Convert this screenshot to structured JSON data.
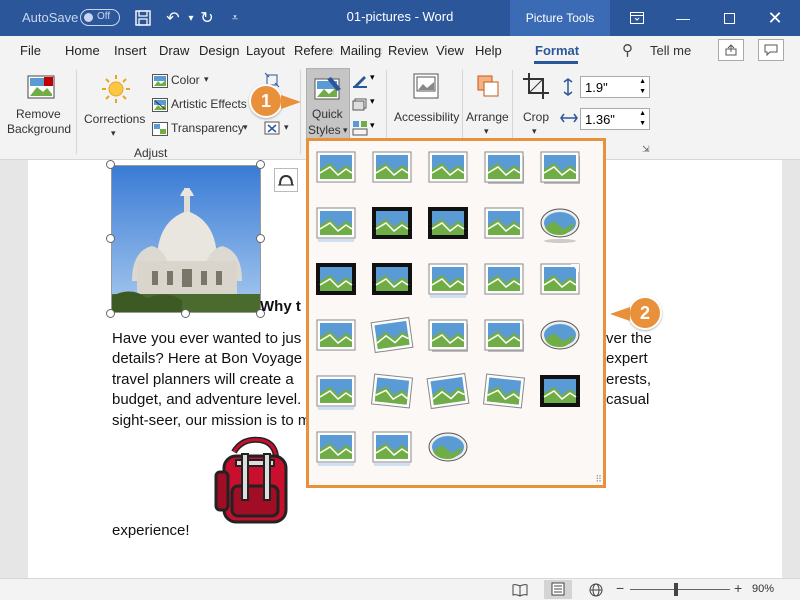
{
  "titlebar": {
    "autosave_label": "AutoSave",
    "autosave_state": "Off",
    "doc_title": "01-pictures - Word",
    "context_tools": "Picture Tools"
  },
  "tabs": {
    "items": [
      "File",
      "Home",
      "Insert",
      "Draw",
      "Design",
      "Layout",
      "References",
      "Mailings",
      "Review",
      "View",
      "Help",
      "Format"
    ],
    "tell_me": "Tell me",
    "active": "Format"
  },
  "ribbon": {
    "remove_background": "Remove Background",
    "corrections": "Corrections",
    "color": "Color",
    "artistic_effects": "Artistic Effects",
    "transparency": "Transparency",
    "adjust_group": "Adjust",
    "quick_styles": "Quick Styles",
    "accessibility": "Accessibility",
    "arrange": "Arrange",
    "crop": "Crop",
    "height": "1.9\"",
    "width": "1.36\""
  },
  "document": {
    "heading_fragment": "Why t",
    "line1_left": "Have you ever wanted to jus",
    "line1_right": "ver the",
    "line2_left": "details? Here at Bon Voyage",
    "line2_right": "expert",
    "line3_left": "travel planners will create a",
    "line3_right": "erests,",
    "line4_left": "budget, and adventure level.",
    "line4_right": "casual",
    "line5_left": "sight-seer, our mission is to m",
    "line6": "experience!"
  },
  "callouts": [
    "1",
    "2"
  ],
  "statusbar": {
    "zoom": "90%"
  },
  "colors": {
    "word_blue": "#2b579a",
    "accent_orange": "#e8913a"
  }
}
